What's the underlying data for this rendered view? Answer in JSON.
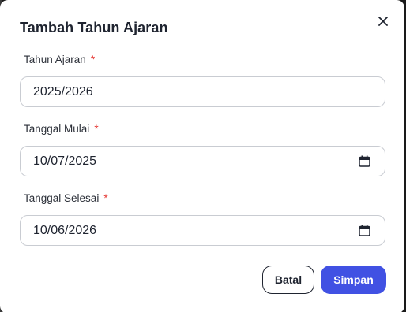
{
  "modal": {
    "title": "Tambah Tahun Ajaran"
  },
  "fields": {
    "tahun_ajaran": {
      "label": "Tahun Ajaran",
      "required_mark": "*",
      "value": "2025/2026"
    },
    "tanggal_mulai": {
      "label": "Tanggal Mulai",
      "required_mark": "*",
      "value": "10/07/2025"
    },
    "tanggal_selesai": {
      "label": "Tanggal Selesai",
      "required_mark": "*",
      "value": "10/06/2026"
    }
  },
  "actions": {
    "cancel_label": "Batal",
    "save_label": "Simpan"
  },
  "colors": {
    "primary": "#4151e3",
    "required": "#e53935",
    "text": "#1f2430"
  },
  "icons": {
    "close": "close-icon",
    "date": "calendar-icon"
  }
}
